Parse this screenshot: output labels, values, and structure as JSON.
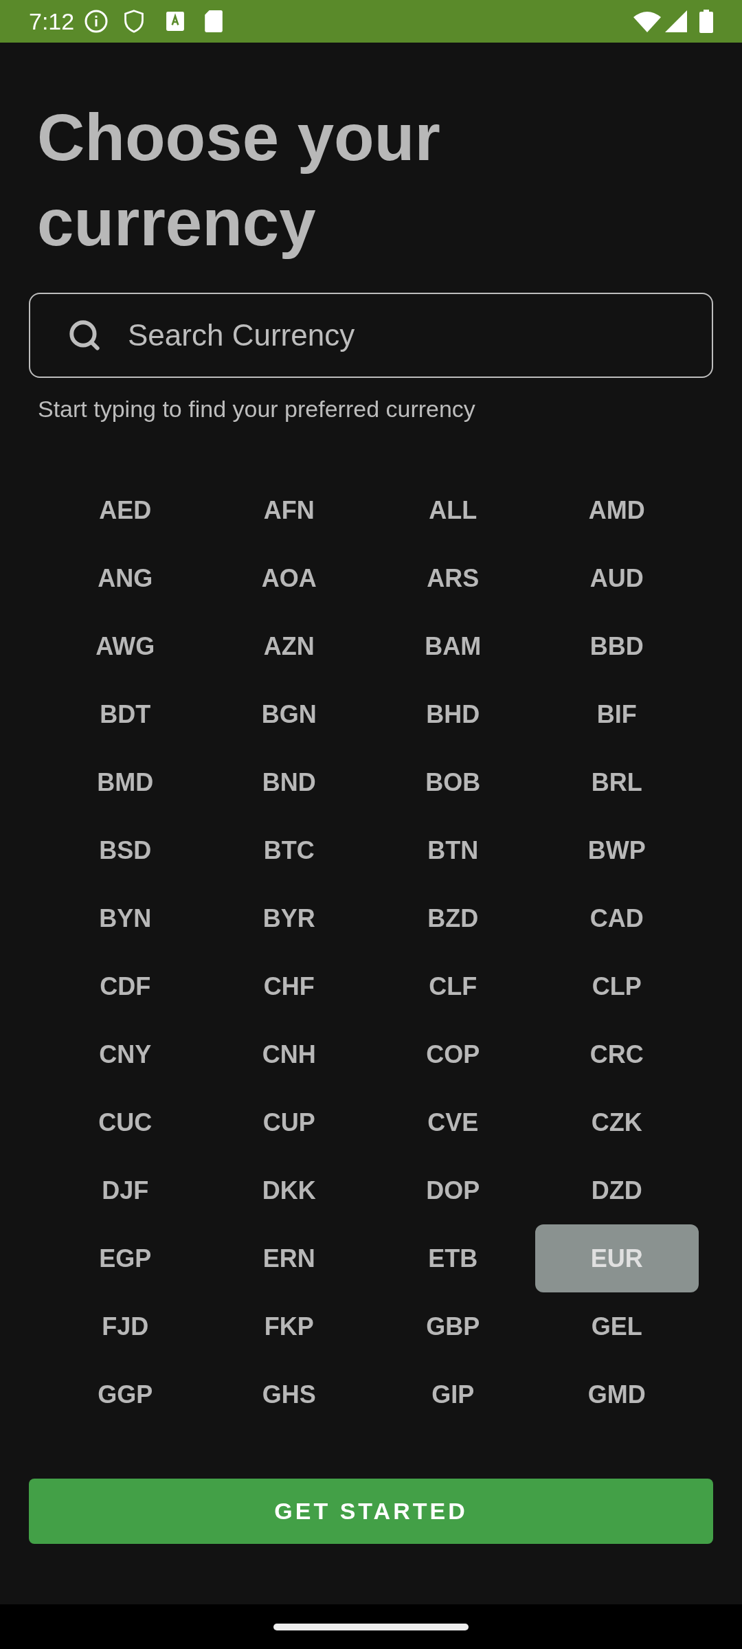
{
  "status_bar": {
    "time": "7:12"
  },
  "title": "Choose your currency",
  "search": {
    "placeholder": "Search Currency",
    "helper": "Start typing to find your preferred currency"
  },
  "currencies": [
    {
      "code": "AED",
      "selected": false
    },
    {
      "code": "AFN",
      "selected": false
    },
    {
      "code": "ALL",
      "selected": false
    },
    {
      "code": "AMD",
      "selected": false
    },
    {
      "code": "ANG",
      "selected": false
    },
    {
      "code": "AOA",
      "selected": false
    },
    {
      "code": "ARS",
      "selected": false
    },
    {
      "code": "AUD",
      "selected": false
    },
    {
      "code": "AWG",
      "selected": false
    },
    {
      "code": "AZN",
      "selected": false
    },
    {
      "code": "BAM",
      "selected": false
    },
    {
      "code": "BBD",
      "selected": false
    },
    {
      "code": "BDT",
      "selected": false
    },
    {
      "code": "BGN",
      "selected": false
    },
    {
      "code": "BHD",
      "selected": false
    },
    {
      "code": "BIF",
      "selected": false
    },
    {
      "code": "BMD",
      "selected": false
    },
    {
      "code": "BND",
      "selected": false
    },
    {
      "code": "BOB",
      "selected": false
    },
    {
      "code": "BRL",
      "selected": false
    },
    {
      "code": "BSD",
      "selected": false
    },
    {
      "code": "BTC",
      "selected": false
    },
    {
      "code": "BTN",
      "selected": false
    },
    {
      "code": "BWP",
      "selected": false
    },
    {
      "code": "BYN",
      "selected": false
    },
    {
      "code": "BYR",
      "selected": false
    },
    {
      "code": "BZD",
      "selected": false
    },
    {
      "code": "CAD",
      "selected": false
    },
    {
      "code": "CDF",
      "selected": false
    },
    {
      "code": "CHF",
      "selected": false
    },
    {
      "code": "CLF",
      "selected": false
    },
    {
      "code": "CLP",
      "selected": false
    },
    {
      "code": "CNY",
      "selected": false
    },
    {
      "code": "CNH",
      "selected": false
    },
    {
      "code": "COP",
      "selected": false
    },
    {
      "code": "CRC",
      "selected": false
    },
    {
      "code": "CUC",
      "selected": false
    },
    {
      "code": "CUP",
      "selected": false
    },
    {
      "code": "CVE",
      "selected": false
    },
    {
      "code": "CZK",
      "selected": false
    },
    {
      "code": "DJF",
      "selected": false
    },
    {
      "code": "DKK",
      "selected": false
    },
    {
      "code": "DOP",
      "selected": false
    },
    {
      "code": "DZD",
      "selected": false
    },
    {
      "code": "EGP",
      "selected": false
    },
    {
      "code": "ERN",
      "selected": false
    },
    {
      "code": "ETB",
      "selected": false
    },
    {
      "code": "EUR",
      "selected": true
    },
    {
      "code": "FJD",
      "selected": false
    },
    {
      "code": "FKP",
      "selected": false
    },
    {
      "code": "GBP",
      "selected": false
    },
    {
      "code": "GEL",
      "selected": false
    },
    {
      "code": "GGP",
      "selected": false
    },
    {
      "code": "GHS",
      "selected": false
    },
    {
      "code": "GIP",
      "selected": false
    },
    {
      "code": "GMD",
      "selected": false
    }
  ],
  "button": "GET STARTED"
}
